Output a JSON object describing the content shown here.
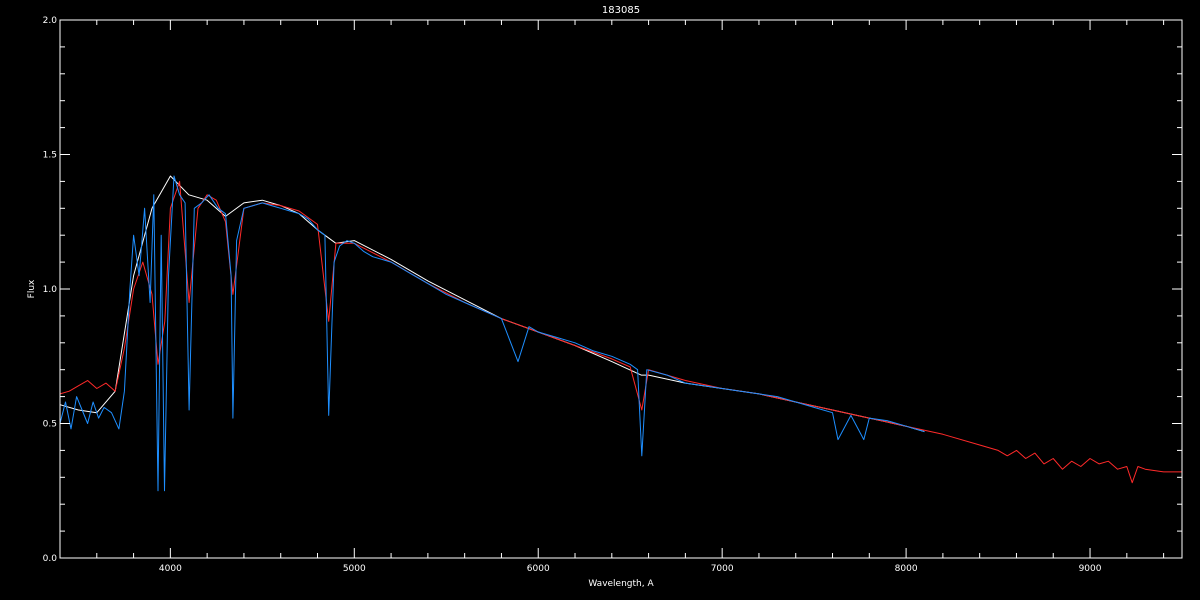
{
  "chart_data": {
    "type": "line",
    "title": "183085",
    "xlabel": "Wavelength, A",
    "ylabel": "Flux",
    "xlim": [
      3400,
      9500
    ],
    "ylim": [
      0.0,
      2.0
    ],
    "x_ticks": [
      {
        "value": 4000,
        "label": "4000"
      },
      {
        "value": 5000,
        "label": "5000"
      },
      {
        "value": 6000,
        "label": "6000"
      },
      {
        "value": 7000,
        "label": "7000"
      },
      {
        "value": 8000,
        "label": "8000"
      },
      {
        "value": 9000,
        "label": "9000"
      }
    ],
    "y_ticks": [
      {
        "value": 0.0,
        "label": "0.0"
      },
      {
        "value": 0.5,
        "label": "0.5"
      },
      {
        "value": 1.0,
        "label": "1.0"
      },
      {
        "value": 1.5,
        "label": "1.5"
      },
      {
        "value": 2.0,
        "label": "2.0"
      }
    ],
    "series": [
      {
        "color": "#ffffff",
        "x": [
          3400,
          3500,
          3600,
          3700,
          3800,
          3900,
          4000,
          4100,
          4200,
          4300,
          4400,
          4500,
          4600,
          4700,
          4800,
          4900,
          5000,
          5200,
          5400,
          5600,
          5800,
          6000,
          6200,
          6400,
          6560,
          6600,
          6800,
          7000,
          7200,
          7400,
          7600,
          7800,
          8000,
          8100
        ],
        "y": [
          0.57,
          0.55,
          0.54,
          0.62,
          1.05,
          1.3,
          1.42,
          1.35,
          1.33,
          1.27,
          1.32,
          1.33,
          1.31,
          1.28,
          1.22,
          1.17,
          1.18,
          1.11,
          1.03,
          0.96,
          0.89,
          0.84,
          0.79,
          0.73,
          0.68,
          0.68,
          0.65,
          0.63,
          0.61,
          0.58,
          0.55,
          0.52,
          0.49,
          0.47
        ]
      },
      {
        "color": "#ff2a2a",
        "x": [
          3400,
          3450,
          3500,
          3550,
          3600,
          3650,
          3700,
          3750,
          3800,
          3850,
          3900,
          3933,
          3970,
          4000,
          4050,
          4102,
          4150,
          4200,
          4250,
          4300,
          4340,
          4400,
          4450,
          4500,
          4600,
          4700,
          4800,
          4861,
          4900,
          5000,
          5200,
          5400,
          5600,
          5800,
          6000,
          6200,
          6400,
          6500,
          6563,
          6600,
          6800,
          7000,
          7200,
          7400,
          7600,
          7800,
          8000,
          8200,
          8400,
          8500,
          8550,
          8600,
          8650,
          8700,
          8750,
          8800,
          8850,
          8900,
          8950,
          9000,
          9050,
          9100,
          9150,
          9200,
          9229,
          9260,
          9300,
          9400,
          9500
        ],
        "y": [
          0.61,
          0.62,
          0.64,
          0.66,
          0.63,
          0.65,
          0.62,
          0.78,
          1.0,
          1.1,
          0.98,
          0.72,
          0.88,
          1.3,
          1.4,
          0.95,
          1.3,
          1.35,
          1.33,
          1.25,
          0.98,
          1.3,
          1.31,
          1.32,
          1.31,
          1.29,
          1.24,
          0.88,
          1.17,
          1.17,
          1.1,
          1.02,
          0.95,
          0.89,
          0.84,
          0.79,
          0.74,
          0.71,
          0.55,
          0.7,
          0.66,
          0.63,
          0.61,
          0.58,
          0.55,
          0.52,
          0.49,
          0.46,
          0.42,
          0.4,
          0.38,
          0.4,
          0.37,
          0.39,
          0.35,
          0.37,
          0.33,
          0.36,
          0.34,
          0.37,
          0.35,
          0.36,
          0.33,
          0.34,
          0.28,
          0.34,
          0.33,
          0.32,
          0.32
        ]
      },
      {
        "color": "#1e8fff",
        "x": [
          3400,
          3430,
          3460,
          3490,
          3520,
          3550,
          3580,
          3610,
          3640,
          3680,
          3720,
          3750,
          3780,
          3800,
          3830,
          3860,
          3890,
          3910,
          3933,
          3950,
          3968,
          3990,
          4020,
          4050,
          4080,
          4102,
          4130,
          4170,
          4210,
          4260,
          4300,
          4330,
          4340,
          4360,
          4400,
          4450,
          4500,
          4550,
          4600,
          4650,
          4700,
          4750,
          4800,
          4840,
          4861,
          4890,
          4920,
          4960,
          5000,
          5050,
          5100,
          5150,
          5200,
          5250,
          5300,
          5350,
          5400,
          5450,
          5500,
          5600,
          5700,
          5800,
          5890,
          5950,
          6000,
          6100,
          6200,
          6300,
          6400,
          6500,
          6540,
          6563,
          6590,
          6700,
          6800,
          6900,
          7000,
          7100,
          7200,
          7300,
          7400,
          7500,
          7600,
          7630,
          7700,
          7770,
          7800,
          7900,
          8000,
          8100
        ],
        "y": [
          0.5,
          0.58,
          0.48,
          0.6,
          0.55,
          0.5,
          0.58,
          0.52,
          0.56,
          0.54,
          0.48,
          0.62,
          1.0,
          1.2,
          1.05,
          1.3,
          0.95,
          1.35,
          0.25,
          1.2,
          0.25,
          1.05,
          1.42,
          1.35,
          1.32,
          0.55,
          1.3,
          1.32,
          1.35,
          1.3,
          1.28,
          1.05,
          0.52,
          1.18,
          1.3,
          1.31,
          1.32,
          1.31,
          1.3,
          1.29,
          1.28,
          1.26,
          1.22,
          1.2,
          0.53,
          1.1,
          1.16,
          1.18,
          1.17,
          1.14,
          1.12,
          1.11,
          1.1,
          1.08,
          1.06,
          1.04,
          1.02,
          1.0,
          0.98,
          0.95,
          0.92,
          0.89,
          0.73,
          0.86,
          0.84,
          0.82,
          0.8,
          0.77,
          0.75,
          0.72,
          0.7,
          0.38,
          0.7,
          0.68,
          0.65,
          0.64,
          0.63,
          0.62,
          0.61,
          0.6,
          0.58,
          0.56,
          0.54,
          0.44,
          0.53,
          0.44,
          0.52,
          0.51,
          0.49,
          0.47
        ]
      }
    ]
  }
}
